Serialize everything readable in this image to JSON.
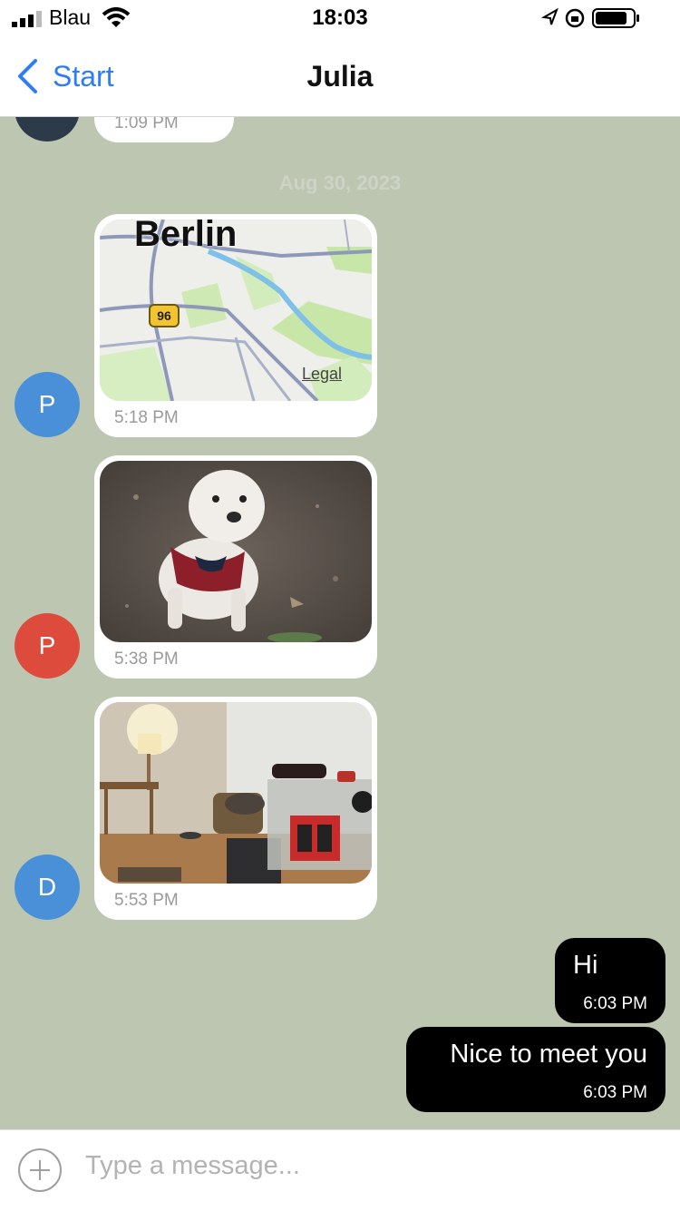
{
  "status_bar": {
    "carrier": "Blau",
    "time": "18:03"
  },
  "nav": {
    "back_label": "Start",
    "title": "Julia"
  },
  "chat": {
    "top_partial_timestamp": "1:09 PM",
    "date_separator": "Aug 30, 2023",
    "incoming": [
      {
        "avatar_letter": "P",
        "avatar_color": "#4a90d9",
        "kind": "map",
        "map_label": "Berlin",
        "road_badge": "96",
        "legal_label": "Legal",
        "timestamp": "5:18 PM"
      },
      {
        "avatar_letter": "P",
        "avatar_color": "#dd4b3c",
        "kind": "photo-dog",
        "timestamp": "5:38 PM"
      },
      {
        "avatar_letter": "D",
        "avatar_color": "#4a90d9",
        "kind": "photo-room",
        "timestamp": "5:53 PM"
      }
    ],
    "outgoing": [
      {
        "text": "Hi",
        "timestamp": "6:03 PM"
      },
      {
        "text": "Nice to meet you",
        "timestamp": "6:03 PM"
      }
    ]
  },
  "composer": {
    "placeholder": "Type a message..."
  },
  "colors": {
    "accent": "#2f7df6",
    "chat_background": "#bcc6b0",
    "outgoing_bubble": "#000000"
  }
}
